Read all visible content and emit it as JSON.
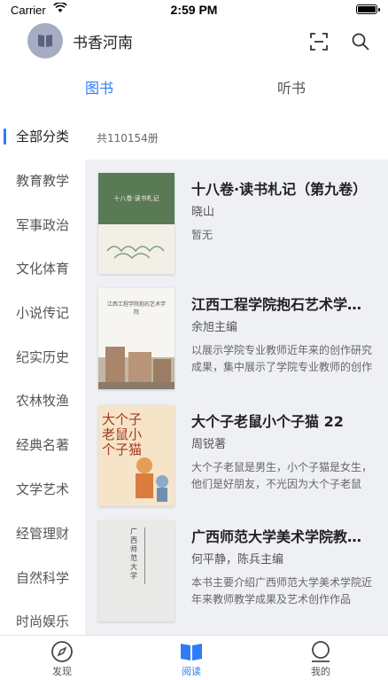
{
  "status": {
    "carrier": "Carrier",
    "time": "2:59 PM"
  },
  "header": {
    "title": "书香河南"
  },
  "tabs": [
    {
      "label": "图书"
    },
    {
      "label": "听书"
    }
  ],
  "sidebar": {
    "items": [
      {
        "label": "全部分类"
      },
      {
        "label": "教育教学"
      },
      {
        "label": "军事政治"
      },
      {
        "label": "文化体育"
      },
      {
        "label": "小说传记"
      },
      {
        "label": "纪实历史"
      },
      {
        "label": "农林牧渔"
      },
      {
        "label": "经典名著"
      },
      {
        "label": "文学艺术"
      },
      {
        "label": "经管理财"
      },
      {
        "label": "自然科学"
      },
      {
        "label": "时尚娱乐"
      }
    ]
  },
  "books_count": "共110154册",
  "books": [
    {
      "title": "十八卷·读书札记（第九卷）",
      "author": "晓山",
      "desc": "暂无",
      "cover_text": "十八卷·读书札记"
    },
    {
      "title": "江西工程学院抱石艺术学院专业教师作品集",
      "author": "余旭主编",
      "desc": "以展示学院专业教师近年来的创作研究成果，集中展示了学院专业教师的创作成果",
      "cover_text": "江西工程学院抱石艺术学院"
    },
    {
      "title": "大个子老鼠小个子猫 22",
      "author": "周锐著",
      "desc": "大个子老鼠是男生，小个子猫是女生，他们是好朋友，不光因为大个子老鼠",
      "cover_text": "大个子老鼠小个子猫"
    },
    {
      "title": "广西师范大学美术学院教师作品集",
      "author": "何平静，陈兵主编",
      "desc": "本书主要介绍广西师范大学美术学院近年来教师教学成果及艺术创作作品",
      "cover_text": "广西师范大学"
    }
  ],
  "tabbar": [
    {
      "label": "发现"
    },
    {
      "label": "阅读"
    },
    {
      "label": "我的"
    }
  ],
  "colors": {
    "accent": "#2f7cf6",
    "panel": "#eef0f4"
  }
}
